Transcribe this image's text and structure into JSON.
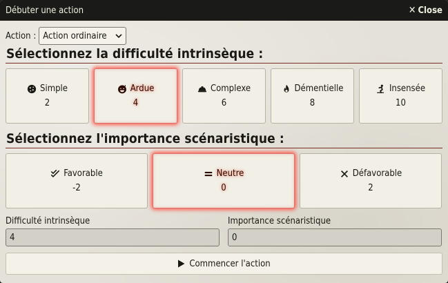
{
  "window": {
    "title": "Débuter une action",
    "close_label": "Close"
  },
  "action": {
    "label": "Action :",
    "selected": "Action ordinaire"
  },
  "difficulty": {
    "heading": "Sélectionnez la difficulté intrinsèque :",
    "options": [
      {
        "label": "Simple",
        "value": "2",
        "icon": "cookie-icon",
        "active": false
      },
      {
        "label": "Ardue",
        "value": "4",
        "icon": "grin-beam-sweat-icon",
        "active": true
      },
      {
        "label": "Complexe",
        "value": "6",
        "icon": "hard-hat-icon",
        "active": false
      },
      {
        "label": "Démentielle",
        "value": "8",
        "icon": "fire-icon",
        "active": false
      },
      {
        "label": "Insensée",
        "value": "10",
        "icon": "skiing-person-icon",
        "active": false
      }
    ]
  },
  "importance": {
    "heading": "Sélectionnez l'importance scénaristique :",
    "options": [
      {
        "label": "Favorable",
        "value": "-2",
        "icon": "double-check-icon",
        "active": false
      },
      {
        "label": "Neutre",
        "value": "0",
        "icon": "equals-icon",
        "active": true
      },
      {
        "label": "Défavorable",
        "value": "2",
        "icon": "x-icon",
        "active": false
      }
    ]
  },
  "fields": {
    "difficulty_label": "Difficulté intrinsèque",
    "difficulty_value": "4",
    "importance_label": "Importance scénaristique",
    "importance_value": "0"
  },
  "start_button": {
    "label": "Commencer l'action"
  },
  "colors": {
    "accent": "#782e22",
    "glow": "#ff5a4e",
    "titlebar": "#1a1a18"
  }
}
